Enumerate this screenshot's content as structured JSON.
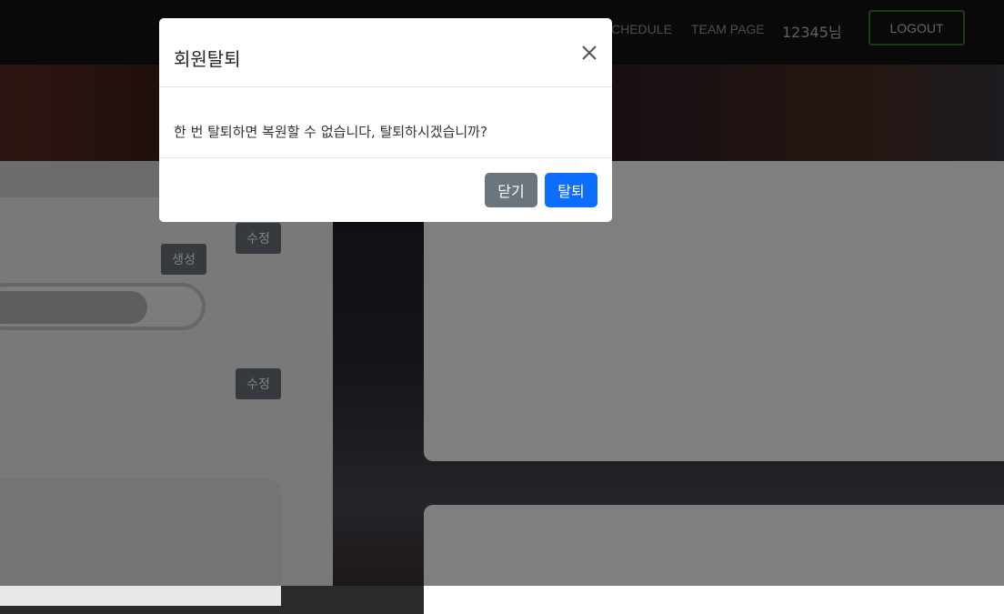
{
  "nav": {
    "schedule": "CHEDULE",
    "team_page": "TEAM PAGE",
    "user": "12345님",
    "logout": "LOGOUT"
  },
  "page": {
    "edit_label": "수정",
    "create_label": "생성"
  },
  "modal": {
    "title": "회원탈퇴",
    "message": "한 번 탈퇴하면 복원할 수 없습니다, 탈퇴하시겠습니까?",
    "close_label": "닫기",
    "confirm_label": "탈퇴",
    "close_icon": "close-icon"
  },
  "colors": {
    "primary": "#0d6efd",
    "secondary": "#6c757d",
    "logout_border": "#3a7a2a"
  }
}
